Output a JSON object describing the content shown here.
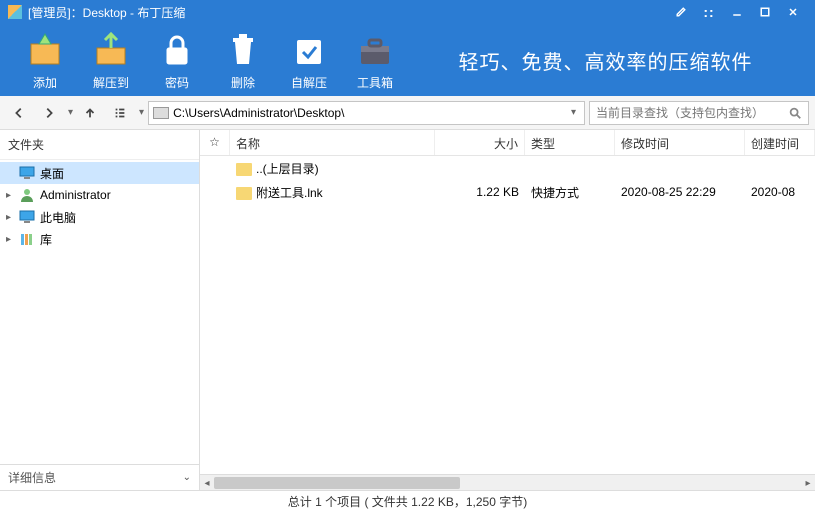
{
  "title": "[管理员]：Desktop - 布丁压缩",
  "toolbar": {
    "add": "添加",
    "extract": "解压到",
    "password": "密码",
    "delete": "删除",
    "sfx": "自解压",
    "toolbox": "工具箱",
    "slogan": "轻巧、免费、高效率的压缩软件"
  },
  "nav": {
    "path": "C:\\Users\\Administrator\\Desktop\\",
    "search_placeholder": "当前目录查找（支持包内查找）"
  },
  "sidebar": {
    "header": "文件夹",
    "items": [
      {
        "label": "桌面",
        "toggle": "",
        "icon": "monitor",
        "selected": true
      },
      {
        "label": "Administrator",
        "toggle": "▸",
        "icon": "user",
        "selected": false
      },
      {
        "label": "此电脑",
        "toggle": "▸",
        "icon": "monitor",
        "selected": false
      },
      {
        "label": "库",
        "toggle": "▸",
        "icon": "library",
        "selected": false
      }
    ],
    "detail": "详细信息"
  },
  "columns": {
    "star": "☆",
    "name": "名称",
    "size": "大小",
    "type": "类型",
    "modified": "修改时间",
    "created": "创建时间"
  },
  "rows": [
    {
      "name": "..(上层目录)",
      "size": "",
      "type": "",
      "modified": "",
      "created": ""
    },
    {
      "name": "附送工具.lnk",
      "size": "1.22 KB",
      "type": "快捷方式",
      "modified": "2020-08-25 22:29",
      "created": "2020-08"
    }
  ],
  "status": "总计 1 个项目 ( 文件共 1.22 KB，1,250 字节)"
}
